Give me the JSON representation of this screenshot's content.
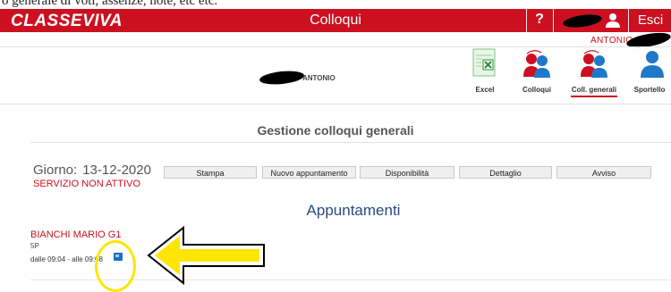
{
  "caption": "o generale di voti, assenze, note, etc etc.",
  "topbar": {
    "logo": "CLASSEVIVA",
    "title": "Colloqui",
    "help": "?",
    "exit": "Esci",
    "accent": "#cc1020"
  },
  "user": {
    "short_name": "ANTONIO",
    "student_label": "ANTONIO"
  },
  "nav": [
    {
      "label": "Excel",
      "icon": "excel-icon"
    },
    {
      "label": "Colloqui",
      "icon": "people-icon"
    },
    {
      "label": "Coll. generali",
      "icon": "people-icon",
      "active": true
    },
    {
      "label": "Sportello",
      "icon": "person-icon"
    }
  ],
  "section_title": "Gestione colloqui generali",
  "day": {
    "label": "Giorno:",
    "value": "13-12-2020",
    "status": "SERVIZIO NON ATTIVO"
  },
  "actions": {
    "stampa": "Stampa",
    "nuovo": "Nuovo appuntamento",
    "disponibilita": "Disponibilità",
    "dettaglio": "Dettaglio",
    "avviso": "Avviso"
  },
  "appointments": {
    "heading": "Appuntamenti",
    "items": [
      {
        "teacher": "BIANCHI MARIO G1",
        "class": "5P",
        "time": "dalle 09:04 - alle 09:08"
      }
    ]
  },
  "annotation": {
    "color": "#ffe600"
  }
}
